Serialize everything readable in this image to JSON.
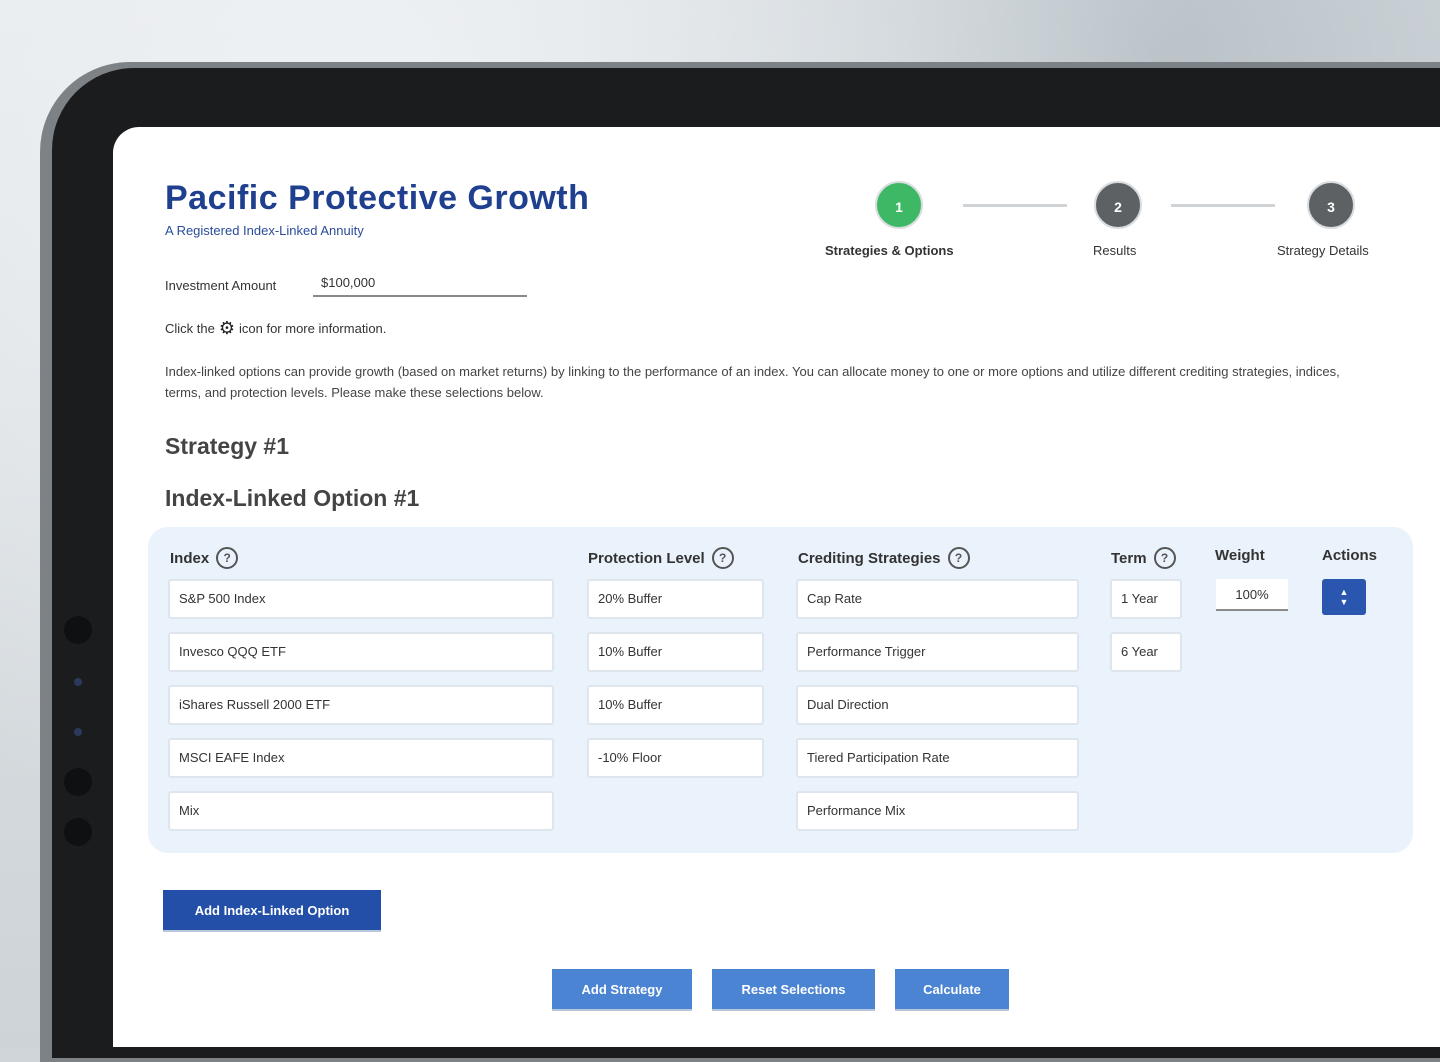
{
  "header": {
    "title": "Pacific Protective Growth",
    "subtitle": "A Registered Index-Linked Annuity"
  },
  "stepper": {
    "steps": [
      {
        "number": "1",
        "label": "Strategies & Options",
        "color": "#3fb866"
      },
      {
        "number": "2",
        "label": "Results",
        "color": "#5e6164"
      },
      {
        "number": "3",
        "label": "Strategy Details",
        "color": "#5e6164"
      }
    ]
  },
  "investment": {
    "label": "Investment Amount",
    "value": "$100,000"
  },
  "info": {
    "prefix": "Click the",
    "icon": "gear-icon",
    "suffix": "icon for more information."
  },
  "description": "Index-linked options can provide growth (based on market returns) by linking to the performance of an index. You can allocate money to one or more options and utilize different crediting strategies, indices, terms, and protection levels. Please make these selections below.",
  "strategy_heading": "Strategy #1",
  "option_heading": "Index-Linked Option #1",
  "options_panel": {
    "columns": {
      "index": "Index",
      "protection": "Protection Level",
      "crediting": "Crediting Strategies",
      "term": "Term",
      "weight": "Weight",
      "actions": "Actions"
    },
    "index_options": [
      "S&P 500 Index",
      "Invesco QQQ ETF",
      "iShares Russell 2000 ETF",
      "MSCI EAFE Index",
      "Mix"
    ],
    "protection_options": [
      "20% Buffer",
      "10% Buffer",
      "10% Buffer",
      "-10% Floor"
    ],
    "crediting_options": [
      "Cap Rate",
      "Performance Trigger",
      "Dual Direction",
      "Tiered Participation Rate",
      "Performance Mix"
    ],
    "term_options": [
      "1 Year",
      "6 Year"
    ],
    "weight_value": "100%",
    "action_button_icon": "up-down-arrows-icon"
  },
  "buttons": {
    "add_option": "Add Index-Linked Option",
    "add_strategy": "Add Strategy",
    "reset": "Reset Selections",
    "calculate": "Calculate"
  }
}
